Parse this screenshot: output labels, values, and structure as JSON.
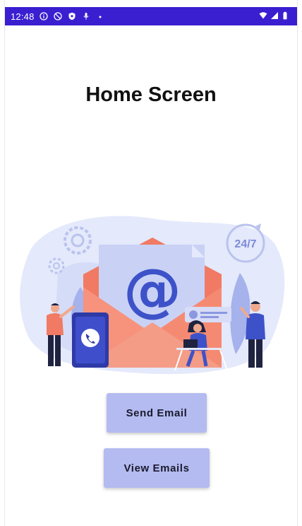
{
  "status_bar": {
    "time": "12:48",
    "icons": [
      "info-icon",
      "do-not-disturb-icon",
      "shield-icon",
      "mic-icon",
      "dot-icon"
    ],
    "right_icons": [
      "wifi-icon",
      "signal-icon",
      "battery-icon"
    ],
    "background": "#3a1fd0"
  },
  "page": {
    "title": "Home Screen"
  },
  "illustration": {
    "availability_badge": "24/7",
    "at_symbol": "@"
  },
  "buttons": {
    "send_email": "Send Email",
    "view_emails": "View Emails",
    "color": "#b4bbf0"
  }
}
